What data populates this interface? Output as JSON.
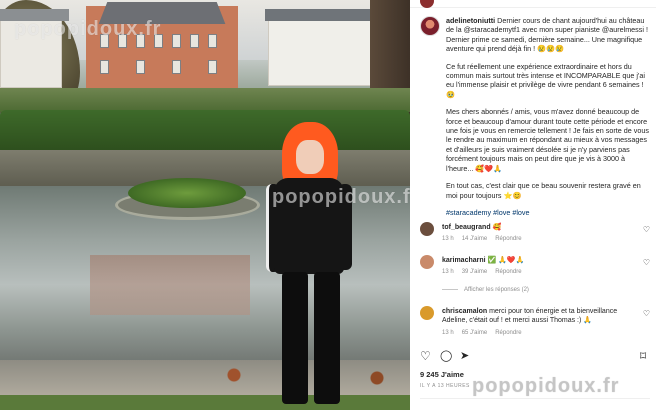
{
  "post_author": "adelinetoniutti",
  "caption": {
    "text_1": "Dernier cours de chant aujourd'hui au château de la @staracademytf1 avec mon super pianiste @aurelmessi ! Dernier prime ce samedi, dernière semaine... Une magnifique aventure qui prend déjà fin ! 😢😢😢",
    "text_2": "Ce fut réellement une expérience extraordinaire et hors du commun mais surtout très intense et INCOMPARABLE que j'ai eu l'immense plaisir et privilège de vivre pendant 6 semaines ! 🥹",
    "text_3": "Mes chers abonnés / amis, vous m'avez donné beaucoup de force et beaucoup d'amour durant toute cette période et encore une fois je vous en remercie tellement ! Je fais en sorte de vous le rendre au maximum en répondant au mieux à vos messages et d'ailleurs je suis vraiment désolée si je n'y parviens pas forcément toujours mais on peut dire que je vis à 3000 à l'heure... 🥰❤️🙏",
    "text_4": "En tout cas, c'est clair que ce beau souvenir restera gravé en moi pour toujours ⭐️😊",
    "hashtags": "#staracademy #love #love"
  },
  "comments": [
    {
      "user": "tof_beaugrand",
      "text": "🥰",
      "time": "13 h",
      "likes": "14 J'aime",
      "reply": "Répondre",
      "avatar_color": "#6b4e3d"
    },
    {
      "user": "karimacharni",
      "text": "✅ 🙏❤️🙏",
      "time": "13 h",
      "likes": "39 J'aime",
      "reply": "Répondre",
      "avatar_color": "#c98a6a"
    },
    {
      "user": "chriscamalon",
      "text": "merci pour ton énergie et ta bienveillance Adeline, c'était ouf ! et merci aussi Thomas :) 🙏",
      "time": "13 h",
      "likes": "65 J'aime",
      "reply": "Répondre",
      "avatar_color": "#d99a2b"
    }
  ],
  "view_replies": "Afficher les réponses (2)",
  "actions": {
    "like_icon": "♡",
    "comment_icon": "◯",
    "share_icon": "➤",
    "save_icon": "⌑"
  },
  "likes_count": "9 245 J'aime",
  "time_ago": "IL Y A 13 HEURES",
  "watermark": "popopidoux.fr"
}
